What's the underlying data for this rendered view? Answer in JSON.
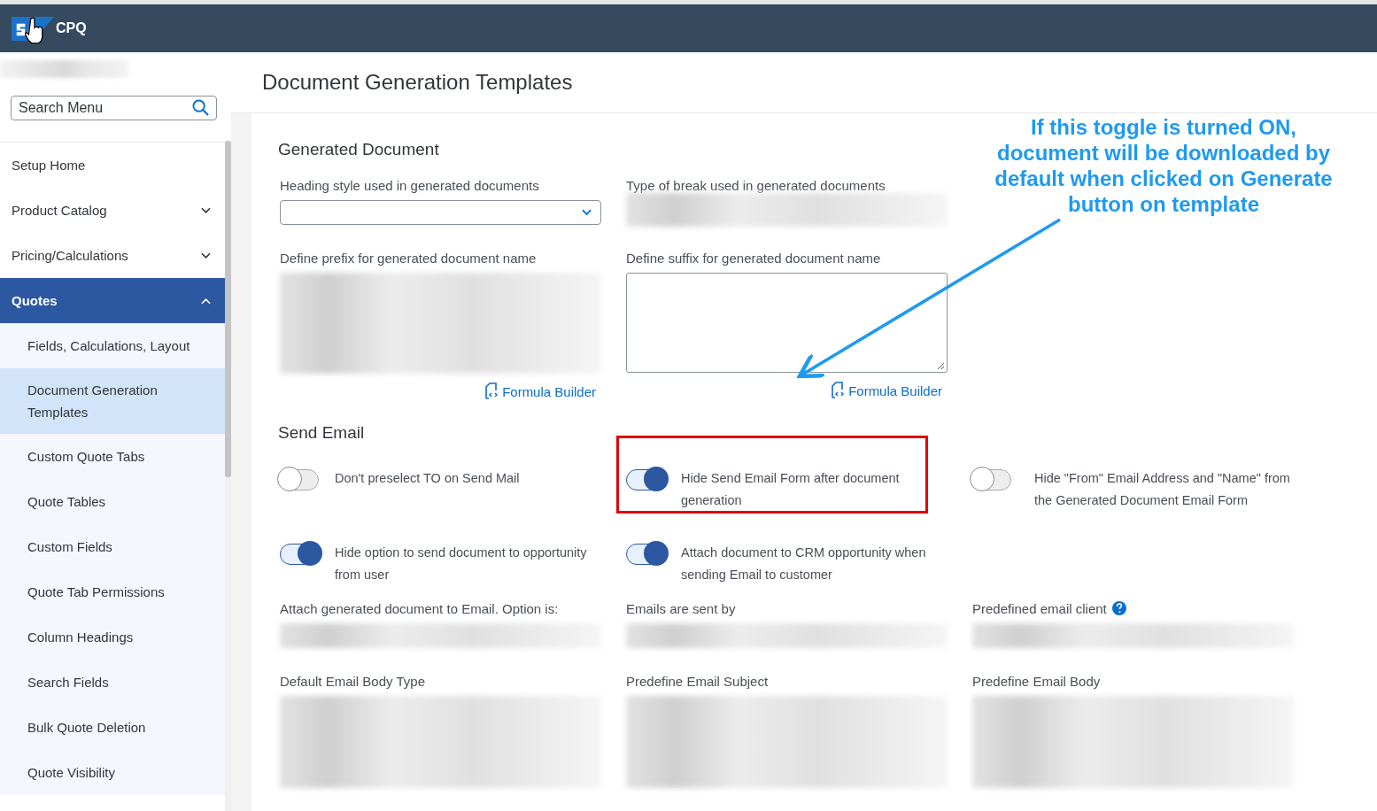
{
  "header": {
    "product": "CPQ"
  },
  "sidebar": {
    "search": {
      "placeholder": "Search Menu"
    },
    "items": [
      {
        "label": "Setup Home",
        "selected": false
      },
      {
        "label": "Product Catalog",
        "selected": false,
        "expanded": false
      },
      {
        "label": "Pricing/Calculations",
        "selected": false,
        "expanded": false
      },
      {
        "label": "Quotes",
        "selected": true,
        "expanded": true,
        "children": [
          {
            "label": "Fields, Calculations, Layout",
            "selected": false
          },
          {
            "label": "Document Generation Templates",
            "selected": true
          },
          {
            "label": "Custom Quote Tabs",
            "selected": false
          },
          {
            "label": "Quote Tables",
            "selected": false
          },
          {
            "label": "Custom Fields",
            "selected": false
          },
          {
            "label": "Quote Tab Permissions",
            "selected": false
          },
          {
            "label": "Column Headings",
            "selected": false
          },
          {
            "label": "Search Fields",
            "selected": false
          },
          {
            "label": "Bulk Quote Deletion",
            "selected": false
          },
          {
            "label": "Quote Visibility",
            "selected": false
          }
        ]
      }
    ]
  },
  "page_title": "Document Generation Templates",
  "generated_document": {
    "title": "Generated Document",
    "fields": [
      {
        "label": "Heading style used in generated documents",
        "kind": "select"
      },
      {
        "label": "Type of break used in generated documents",
        "kind": "blurred"
      },
      {
        "label": "Define prefix for generated document name",
        "kind": "blurred-area",
        "link": "Formula Builder"
      },
      {
        "label": "Define suffix for generated document name",
        "kind": "textarea",
        "link": "Formula Builder"
      }
    ]
  },
  "send_email": {
    "title": "Send Email",
    "toggles": [
      {
        "label": "Don't preselect TO on Send Mail",
        "on": false,
        "highlighted": false
      },
      {
        "label": "Hide Send Email Form after document generation",
        "on": true,
        "highlighted": true
      },
      {
        "label": "Hide \"From\" Email Address and \"Name\" from the Generated Document Email Form",
        "on": false,
        "highlighted": false
      },
      {
        "label": "Hide option to send document to opportunity from user",
        "on": true,
        "highlighted": false
      },
      {
        "label": "Attach document to CRM opportunity when sending Email to customer",
        "on": true,
        "highlighted": false
      }
    ],
    "fields": [
      {
        "label": "Attach generated document to Email. Option is:",
        "kind": "blurred"
      },
      {
        "label": "Emails are sent by",
        "kind": "blurred"
      },
      {
        "label": "Predefined email client",
        "kind": "blurred",
        "help": true
      },
      {
        "label": "Default Email Body Type",
        "kind": "blurred-tall"
      },
      {
        "label": "Predefine Email Subject",
        "kind": "blurred-tall"
      },
      {
        "label": "Predefine Email Body",
        "kind": "blurred-tall"
      }
    ]
  },
  "annotation": {
    "text": "If this toggle is turned ON, document will be downloaded by default when clicked on Generate button on template"
  }
}
